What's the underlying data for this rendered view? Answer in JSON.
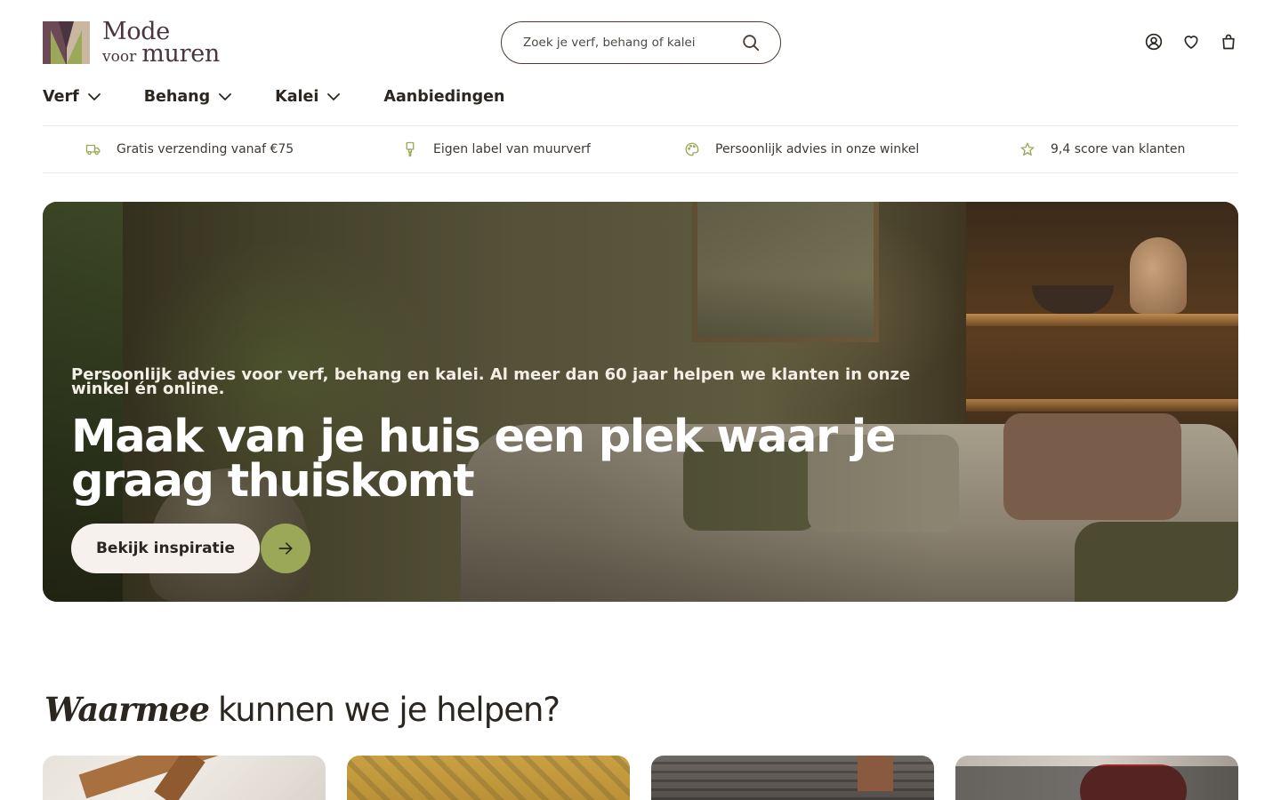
{
  "brand": {
    "line1": "Mode",
    "line2_small": "voor",
    "line2_large": "muren",
    "colors": {
      "dark": "#4a3440",
      "green": "#9aa857",
      "plum": "#6b4a56"
    }
  },
  "search": {
    "placeholder": "Zoek je verf, behang of kalei",
    "icon": "search-icon"
  },
  "header_icons": [
    "account-icon",
    "heart-icon",
    "shopping-bag-icon"
  ],
  "nav": {
    "items": [
      {
        "label": "Verf",
        "has_dropdown": true
      },
      {
        "label": "Behang",
        "has_dropdown": true
      },
      {
        "label": "Kalei",
        "has_dropdown": true
      },
      {
        "label": "Aanbiedingen",
        "has_dropdown": false
      }
    ]
  },
  "usps": [
    {
      "icon": "truck-icon",
      "label": "Gratis verzending vanaf €75"
    },
    {
      "icon": "paint-brush-icon",
      "label": "Eigen label van muurverf"
    },
    {
      "icon": "palette-icon",
      "label": "Persoonlijk advies in onze winkel"
    },
    {
      "icon": "star-icon",
      "label": "9,4 score van klanten"
    }
  ],
  "hero": {
    "subtitle": "Persoonlijk advies voor verf, behang en kalei. Al meer dan 60 jaar helpen we klanten in onze winkel én online.",
    "title": "Maak van je huis een plek waar je graag thuiskomt",
    "cta_label": "Bekijk inspiratie",
    "cta_icon": "arrow-right-icon",
    "accent": "#9aa857"
  },
  "help_section": {
    "title_emphasis": "Waarmee",
    "title_rest": "kunnen we je helpen?"
  }
}
